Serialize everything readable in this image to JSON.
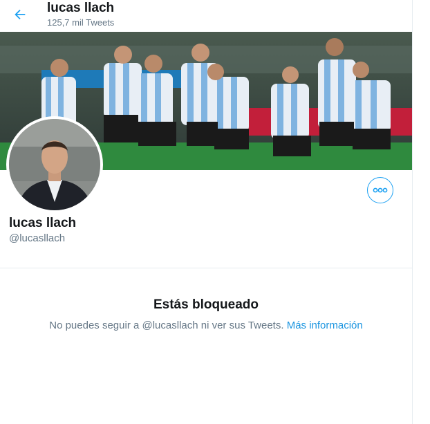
{
  "header": {
    "title": "lucas llach",
    "subtitle": "125,7 mil Tweets"
  },
  "profile": {
    "name": "lucas llach",
    "handle": "@lucasllach"
  },
  "blocked": {
    "title": "Estás bloqueado",
    "message": "No puedes seguir a @lucasllach ni ver sus Tweets.",
    "link": "Más información"
  },
  "icons": {
    "back": "arrow-left-icon",
    "more": "more-horizontal-icon"
  },
  "colors": {
    "accent": "#1da1f2",
    "link": "#1b95e0",
    "text": "#14171a",
    "muted": "#657786"
  }
}
